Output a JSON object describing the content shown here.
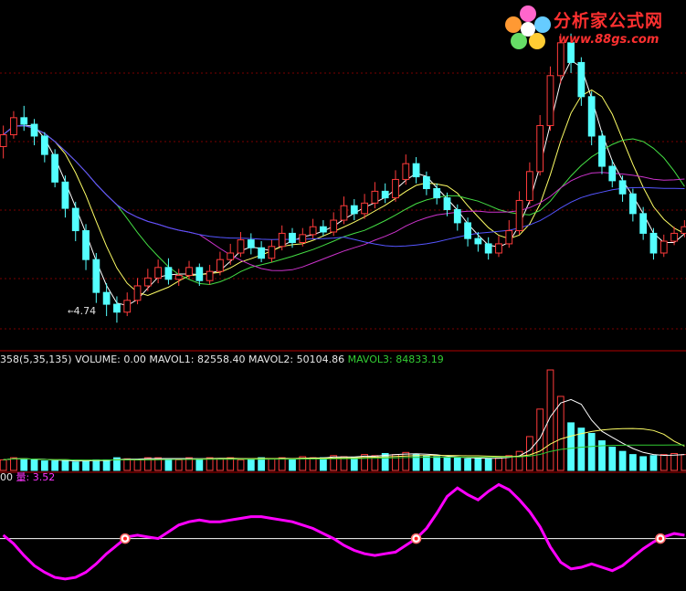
{
  "colors": {
    "background": "#000000",
    "up": "#ff3b3b",
    "down": "#54ffff",
    "ma_white": "#ffffff",
    "ma_yellow": "#ffff66",
    "ma_green": "#44dd44",
    "ma_magenta": "#cc33cc",
    "ma_blue": "#5555ff",
    "grid": "#7a0000",
    "indicator": "#ff00ff"
  },
  "logo": {
    "text": "分析家公式网",
    "url": "www.88gs.com",
    "icon": "flower-logo-icon"
  },
  "low_label": "4.74",
  "vol_legend": {
    "params": "358(5,35,135)",
    "volume": "VOLUME: 0.00",
    "mavol1": "MAVOL1: 82558.40",
    "mavol2": "MAVOL2: 50104.86",
    "mavol3": "MAVOL3: 84833.19"
  },
  "ind_legend": {
    "prefix": "00",
    "name": "量",
    "value": ": 3.52"
  },
  "chart_data": [
    {
      "type": "candlestick",
      "panel": "price",
      "annotation_low": 4.74,
      "ma_series": [
        "white",
        "yellow",
        "green",
        "magenta",
        "blue"
      ],
      "candles": [
        [
          4.14,
          4.23,
          4.3,
          4.05
        ],
        [
          4.23,
          4.36,
          4.41,
          4.2
        ],
        [
          4.36,
          4.31,
          4.45,
          4.26
        ],
        [
          4.31,
          4.22,
          4.35,
          4.15
        ],
        [
          4.22,
          4.08,
          4.25,
          4.02
        ],
        [
          4.08,
          3.87,
          4.12,
          3.83
        ],
        [
          3.87,
          3.67,
          3.92,
          3.6
        ],
        [
          3.67,
          3.5,
          3.72,
          3.42
        ],
        [
          3.5,
          3.28,
          3.55,
          3.2
        ],
        [
          3.28,
          3.03,
          3.33,
          2.95
        ],
        [
          3.03,
          2.94,
          3.1,
          2.85
        ],
        [
          2.94,
          2.88,
          3.0,
          2.8
        ],
        [
          2.88,
          2.97,
          3.03,
          2.85
        ],
        [
          2.97,
          3.08,
          3.14,
          2.94
        ],
        [
          3.08,
          3.14,
          3.21,
          3.04
        ],
        [
          3.14,
          3.22,
          3.28,
          3.1
        ],
        [
          3.22,
          3.13,
          3.29,
          3.09
        ],
        [
          3.13,
          3.16,
          3.21,
          3.08
        ],
        [
          3.16,
          3.22,
          3.27,
          3.13
        ],
        [
          3.22,
          3.12,
          3.25,
          3.08
        ],
        [
          3.12,
          3.19,
          3.24,
          3.09
        ],
        [
          3.19,
          3.28,
          3.34,
          3.16
        ],
        [
          3.28,
          3.33,
          3.4,
          3.24
        ],
        [
          3.33,
          3.43,
          3.49,
          3.3
        ],
        [
          3.43,
          3.37,
          3.48,
          3.32
        ],
        [
          3.37,
          3.29,
          3.42,
          3.26
        ],
        [
          3.29,
          3.38,
          3.43,
          3.26
        ],
        [
          3.38,
          3.48,
          3.54,
          3.35
        ],
        [
          3.48,
          3.41,
          3.52,
          3.37
        ],
        [
          3.41,
          3.47,
          3.52,
          3.38
        ],
        [
          3.47,
          3.53,
          3.59,
          3.44
        ],
        [
          3.53,
          3.49,
          3.58,
          3.46
        ],
        [
          3.49,
          3.58,
          3.64,
          3.46
        ],
        [
          3.58,
          3.69,
          3.76,
          3.55
        ],
        [
          3.69,
          3.63,
          3.74,
          3.58
        ],
        [
          3.63,
          3.71,
          3.78,
          3.59
        ],
        [
          3.71,
          3.8,
          3.87,
          3.67
        ],
        [
          3.8,
          3.75,
          3.86,
          3.71
        ],
        [
          3.75,
          3.89,
          3.96,
          3.72
        ],
        [
          3.89,
          4.01,
          4.08,
          3.85
        ],
        [
          4.01,
          3.91,
          4.06,
          3.86
        ],
        [
          3.91,
          3.82,
          3.95,
          3.77
        ],
        [
          3.82,
          3.75,
          3.86,
          3.7
        ],
        [
          3.75,
          3.66,
          3.79,
          3.61
        ],
        [
          3.66,
          3.56,
          3.7,
          3.5
        ],
        [
          3.56,
          3.44,
          3.6,
          3.38
        ],
        [
          3.44,
          3.4,
          3.49,
          3.34
        ],
        [
          3.4,
          3.33,
          3.45,
          3.28
        ],
        [
          3.33,
          3.4,
          3.46,
          3.3
        ],
        [
          3.4,
          3.5,
          3.58,
          3.37
        ],
        [
          3.5,
          3.73,
          3.8,
          3.47
        ],
        [
          3.73,
          3.95,
          4.02,
          3.7
        ],
        [
          3.95,
          4.3,
          4.38,
          3.92
        ],
        [
          4.3,
          4.68,
          4.75,
          4.26
        ],
        [
          4.68,
          4.93,
          5.0,
          4.62
        ],
        [
          4.93,
          4.78,
          5.0,
          4.7
        ],
        [
          4.78,
          4.52,
          4.82,
          4.45
        ],
        [
          4.52,
          4.22,
          4.56,
          4.15
        ],
        [
          4.22,
          3.99,
          4.26,
          3.93
        ],
        [
          3.99,
          3.88,
          4.04,
          3.83
        ],
        [
          3.88,
          3.78,
          3.92,
          3.72
        ],
        [
          3.78,
          3.63,
          3.82,
          3.57
        ],
        [
          3.63,
          3.48,
          3.68,
          3.43
        ],
        [
          3.48,
          3.33,
          3.52,
          3.28
        ],
        [
          3.33,
          3.42,
          3.47,
          3.3
        ],
        [
          3.42,
          3.48,
          3.53,
          3.39
        ],
        [
          3.48,
          3.53,
          3.58,
          3.45
        ]
      ],
      "volume": [
        0.1,
        0.12,
        0.11,
        0.1,
        0.09,
        0.09,
        0.1,
        0.08,
        0.09,
        0.1,
        0.1,
        0.12,
        0.11,
        0.1,
        0.12,
        0.12,
        0.11,
        0.1,
        0.12,
        0.11,
        0.12,
        0.11,
        0.12,
        0.1,
        0.11,
        0.12,
        0.11,
        0.12,
        0.1,
        0.13,
        0.12,
        0.12,
        0.14,
        0.13,
        0.12,
        0.15,
        0.14,
        0.16,
        0.15,
        0.17,
        0.15,
        0.14,
        0.13,
        0.12,
        0.12,
        0.11,
        0.12,
        0.11,
        0.12,
        0.14,
        0.18,
        0.32,
        0.58,
        0.95,
        0.7,
        0.45,
        0.4,
        0.35,
        0.28,
        0.22,
        0.18,
        0.15,
        0.13,
        0.14,
        0.15,
        0.16,
        0.15
      ],
      "ylim": [
        2.6,
        5.2
      ]
    },
    {
      "type": "line",
      "panel": "indicator",
      "name": "量",
      "last_value": 3.52,
      "baseline": 0,
      "values": [
        0.2,
        -0.3,
        -1.0,
        -1.6,
        -2.0,
        -2.3,
        -2.4,
        -2.3,
        -2.0,
        -1.5,
        -0.9,
        -0.4,
        0.1,
        0.2,
        0.1,
        0.0,
        0.4,
        0.8,
        1.0,
        1.1,
        1.0,
        1.0,
        1.1,
        1.2,
        1.3,
        1.3,
        1.2,
        1.1,
        1.0,
        0.8,
        0.6,
        0.3,
        0.0,
        -0.4,
        -0.7,
        -0.9,
        -1.0,
        -0.9,
        -0.8,
        -0.4,
        0.0,
        0.6,
        1.5,
        2.5,
        3.0,
        2.6,
        2.3,
        2.8,
        3.2,
        2.9,
        2.3,
        1.6,
        0.7,
        -0.5,
        -1.4,
        -1.8,
        -1.7,
        -1.5,
        -1.7,
        -1.9,
        -1.6,
        -1.1,
        -0.6,
        -0.2,
        0.1,
        0.3,
        0.2
      ],
      "cross_markers": 5,
      "ylim": [
        -3,
        3.5
      ]
    }
  ]
}
